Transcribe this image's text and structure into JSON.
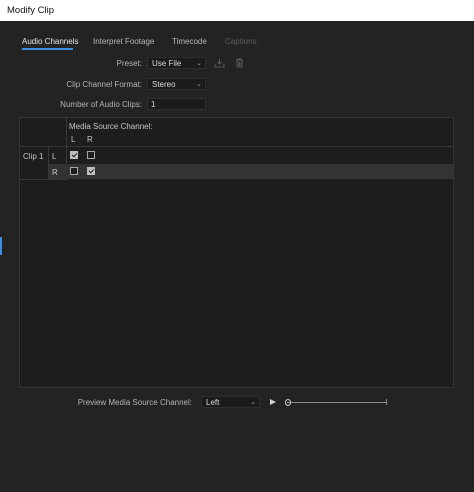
{
  "window": {
    "title": "Modify Clip"
  },
  "tabs": [
    {
      "label": "Audio Channels",
      "state": "active"
    },
    {
      "label": "Interpret Footage",
      "state": "normal"
    },
    {
      "label": "Timecode",
      "state": "normal"
    },
    {
      "label": "Captions",
      "state": "disabled"
    }
  ],
  "form": {
    "preset_label": "Preset:",
    "preset_value": "Use File",
    "format_label": "Clip Channel Format:",
    "format_value": "Stereo",
    "num_clips_label": "Number of Audio Clips:",
    "num_clips_value": "1"
  },
  "table": {
    "source_header": "Media Source Channel:",
    "col_left": "L",
    "col_right": "R",
    "clip_label": "Clip 1",
    "rows": [
      {
        "channel": "L",
        "left_checked": true,
        "right_checked": false
      },
      {
        "channel": "R",
        "left_checked": false,
        "right_checked": true
      }
    ]
  },
  "preview": {
    "label": "Preview Media Source Channel:",
    "channel_value": "Left",
    "position": 0
  },
  "icons": {
    "chevron": "chevron-down-icon",
    "save_preset": "save-preset-icon",
    "delete_preset": "trash-icon",
    "play": "play-icon"
  },
  "colors": {
    "accent": "#3e8ede",
    "background": "#232323",
    "panel": "#1d1d1d",
    "highlight_row": "#333333"
  }
}
